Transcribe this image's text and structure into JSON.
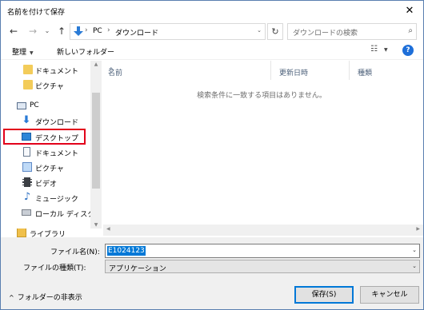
{
  "window": {
    "title": "名前を付けて保存",
    "close_glyph": "✕"
  },
  "navigation": {
    "back_glyph": "←",
    "forward_glyph": "→",
    "history_glyph": "⌄",
    "up_glyph": "↑",
    "address": [
      "PC",
      "ダウンロード"
    ],
    "address_separator": "›",
    "refresh_glyph": "↻",
    "search_placeholder": "ダウンロードの検索",
    "search_icon": "⌕"
  },
  "toolbar": {
    "organize_label": "整理",
    "organize_arrow": "▼",
    "new_folder_label": "新しいフォルダー",
    "view_glyph": "☷",
    "view_arrow": "▼",
    "help_glyph": "?"
  },
  "sidebar": {
    "items": [
      {
        "label": "ドキュメント",
        "icon": "folder-icon"
      },
      {
        "label": "ピクチャ",
        "icon": "folder-icon"
      },
      {
        "label": "PC",
        "icon": "computer-icon"
      },
      {
        "label": "ダウンロード",
        "icon": "download-icon"
      },
      {
        "label": "デスクトップ",
        "icon": "desktop-icon"
      },
      {
        "label": "ドキュメント",
        "icon": "document-icon"
      },
      {
        "label": "ピクチャ",
        "icon": "pictures-icon"
      },
      {
        "label": "ビデオ",
        "icon": "video-icon"
      },
      {
        "label": "ミュージック",
        "icon": "music-icon"
      },
      {
        "label": "ローカル ディスク (C",
        "icon": "drive-icon"
      },
      {
        "label": "ライブラリ",
        "icon": "library-icon"
      }
    ],
    "download_glyph": "⬇",
    "music_glyph": "♪",
    "scroll_up": "▲",
    "scroll_down": "▼",
    "highlight_color": "#e2001a"
  },
  "filelist": {
    "columns": [
      "名前",
      "更新日時",
      "種類"
    ],
    "sort_glyph": "^",
    "empty_message": "検索条件に一致する項目はありません。",
    "hscroll_left": "◀",
    "hscroll_right": "▶"
  },
  "form": {
    "filename_label": "ファイル名(N):",
    "filename_value": "E1024123",
    "filetype_label": "ファイルの種類(T):",
    "filetype_value": "アプリケーション",
    "dropdown_glyph": "⌄",
    "folder_toggle_caret": "^",
    "folder_toggle_label": "フォルダーの非表示",
    "save_label": "保存(S)",
    "cancel_label": "キャンセル"
  },
  "colors": {
    "accent": "#0078d7",
    "border": "#5a7fb0",
    "highlight": "#e2001a"
  }
}
